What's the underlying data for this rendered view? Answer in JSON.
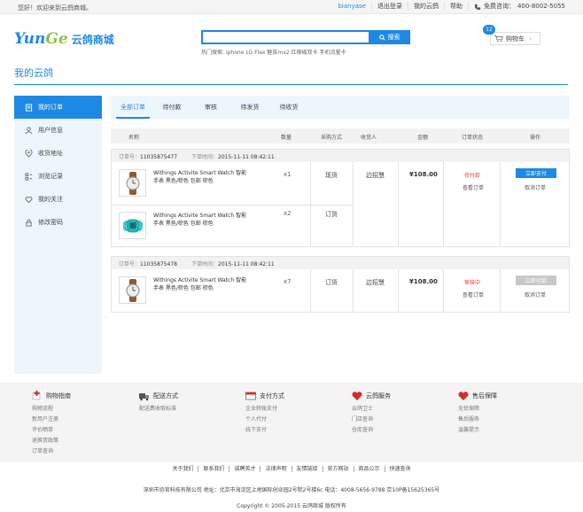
{
  "topbar": {
    "greeting": "您好！欢迎来到云鸽商城。",
    "username": "bianyase",
    "logout": "退出登录",
    "my_account": "我的云鸽",
    "help": "帮助",
    "hotline_label": "免费咨询：",
    "hotline": "400-8002-5055"
  },
  "header": {
    "logo_y": "Yun",
    "logo_g": "Ge",
    "logo_cn": "云鸽商城",
    "search_placeholder": "",
    "search_button": "搜索",
    "hot_label": "热门搜索:",
    "hot_terms": [
      "iphone",
      "LG Flex",
      "魅族mx2",
      "红辣椒双卡",
      "手机流量卡"
    ],
    "cart_label": "购物车",
    "cart_count": "12"
  },
  "page_title": "我的云鸽",
  "sidebar": {
    "items": [
      {
        "label": "我的订单",
        "icon": "order-icon"
      },
      {
        "label": "用户信息",
        "icon": "user-icon"
      },
      {
        "label": "收货地址",
        "icon": "location-icon"
      },
      {
        "label": "浏览记录",
        "icon": "history-icon"
      },
      {
        "label": "我的关注",
        "icon": "heart-icon"
      },
      {
        "label": "修改密码",
        "icon": "lock-icon"
      }
    ]
  },
  "tabs": [
    "全部订单",
    "待付款",
    "审核",
    "待发货",
    "待收货"
  ],
  "table_headers": {
    "name": "名称",
    "qty": "数量",
    "method": "采购方式",
    "receiver": "收货人",
    "amount": "金额",
    "status": "订单状态",
    "action": "操作"
  },
  "orders": [
    {
      "no_label": "订单号：",
      "no": "11035875477",
      "time_label": "下单时间：",
      "time": "2015-11-11 08:42:11",
      "receiver": "边招慧",
      "amount": "¥108.00",
      "status": "待付款",
      "view": "查看订单",
      "pay": "立即支付",
      "cancel": "取消订单",
      "products": [
        {
          "name": "Withings Activite Smart Watch 智能手表 黑色/棕色 包邮 棕色",
          "qty": "x1",
          "method": "现货"
        },
        {
          "name": "Withings Activite Smart Watch 智能手表 黑色/棕色 包邮 棕色",
          "qty": "x2",
          "method": "订货"
        }
      ]
    },
    {
      "no_label": "订单号：",
      "no": "11035875478",
      "time_label": "下单时间：",
      "time": "2015-11-11 08:42:11",
      "receiver": "边招慧",
      "amount": "¥108.00",
      "status": "审核中",
      "view": "查看订单",
      "pay": "立即付款",
      "cancel": "取消订单",
      "products": [
        {
          "name": "Withings Activite Smart Watch 智能手表 黑色/棕色 包邮 棕色",
          "qty": "x7",
          "method": "订货"
        }
      ]
    }
  ],
  "colors": {
    "primary": "#1e88e5",
    "danger": "#e53935",
    "disabled": "#c8c8c8"
  },
  "guide": [
    {
      "title": "购物指南",
      "icon": "cart-plus-icon",
      "links": [
        "购物流程",
        "新用户注册",
        "评价晒单",
        "退换货政策",
        "订单查询"
      ]
    },
    {
      "title": "配送方式",
      "icon": "truck-icon",
      "links": [
        "配送费收取标准"
      ]
    },
    {
      "title": "支付方式",
      "icon": "card-icon",
      "links": [
        "企业转账支付",
        "个人代付",
        "线下支付"
      ]
    },
    {
      "title": "云鸽服务",
      "icon": "heart-icon",
      "links": [
        "云鸽卫士",
        "门店查询",
        "仓库查询"
      ]
    },
    {
      "title": "售后保障",
      "icon": "heart-icon",
      "links": [
        "无忧保障",
        "售后服务",
        "温馨提示"
      ]
    }
  ],
  "footer": {
    "links": [
      "关于我们",
      "联系我们",
      "诚聘英才",
      "法律声明",
      "友情链接",
      "官方网站",
      "商品公示",
      "快速查询"
    ],
    "address": "深圳市协官科技有限公司  地址：北京市海淀区上地国际创业园2号院2号楼6c  电话：4008-5656-9788  京10P备15625365号",
    "copyright": "Copyright © 2005-2015 云鸽商城  版权所有"
  }
}
